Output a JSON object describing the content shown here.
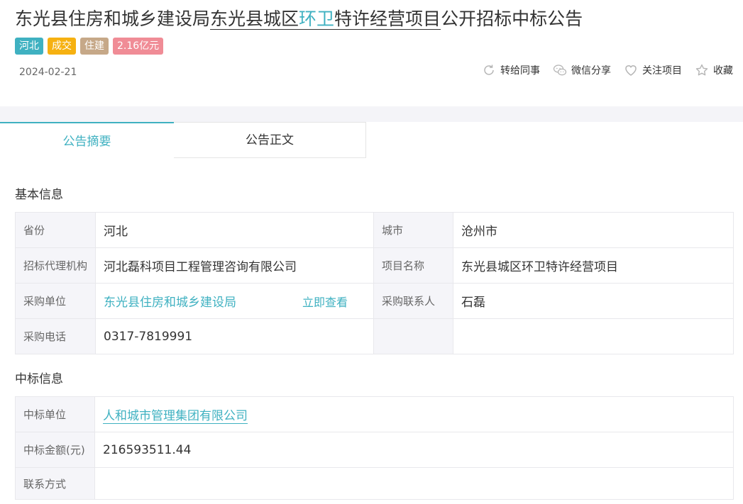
{
  "header": {
    "title_part1": "东光县住房和城乡建设局",
    "title_part2": "东光县城区",
    "title_part3": "环卫",
    "title_part4": "特许经营项目",
    "title_part5": "公开招标中标公告",
    "tags": [
      {
        "label": "河北",
        "color": "#3fb1c1"
      },
      {
        "label": "成交",
        "color": "#f6b111"
      },
      {
        "label": "住建",
        "color": "#c6a888"
      },
      {
        "label": "2.16亿元",
        "color": "#f08c96"
      }
    ],
    "date": "2024-02-21",
    "actions": [
      {
        "label": "转给同事",
        "icon": "forward-icon"
      },
      {
        "label": "微信分享",
        "icon": "wechat-icon"
      },
      {
        "label": "关注项目",
        "icon": "heart-icon"
      },
      {
        "label": "收藏",
        "icon": "star-icon"
      }
    ]
  },
  "tabs": [
    {
      "label": "公告摘要",
      "active": true
    },
    {
      "label": "公告正文",
      "active": false
    }
  ],
  "basic_info": {
    "title": "基本信息",
    "province_label": "省份",
    "province_value": "河北",
    "city_label": "城市",
    "city_value": "沧州市",
    "agency_label": "招标代理机构",
    "agency_value": "河北磊科项目工程管理咨询有限公司",
    "project_label": "项目名称",
    "project_value": "东光县城区环卫特许经营项目",
    "buyer_label": "采购单位",
    "buyer_value": "东光县住房和城乡建设局",
    "view_now": "立即查看",
    "contact_label": "采购联系人",
    "contact_value": "石磊",
    "phone_label": "采购电话",
    "phone_value": "0317-7819991"
  },
  "winner_info": {
    "title": "中标信息",
    "winner_label": "中标单位",
    "winner_value": "人和城市管理集团有限公司",
    "amount_label": "中标金额(元)",
    "amount_value": "216593511.44",
    "contact_label": "联系方式",
    "contact_value": ""
  },
  "colors": {
    "accent": "#3fb1c1",
    "label_bg": "#f5f5f9",
    "border": "#e8e8ec"
  }
}
